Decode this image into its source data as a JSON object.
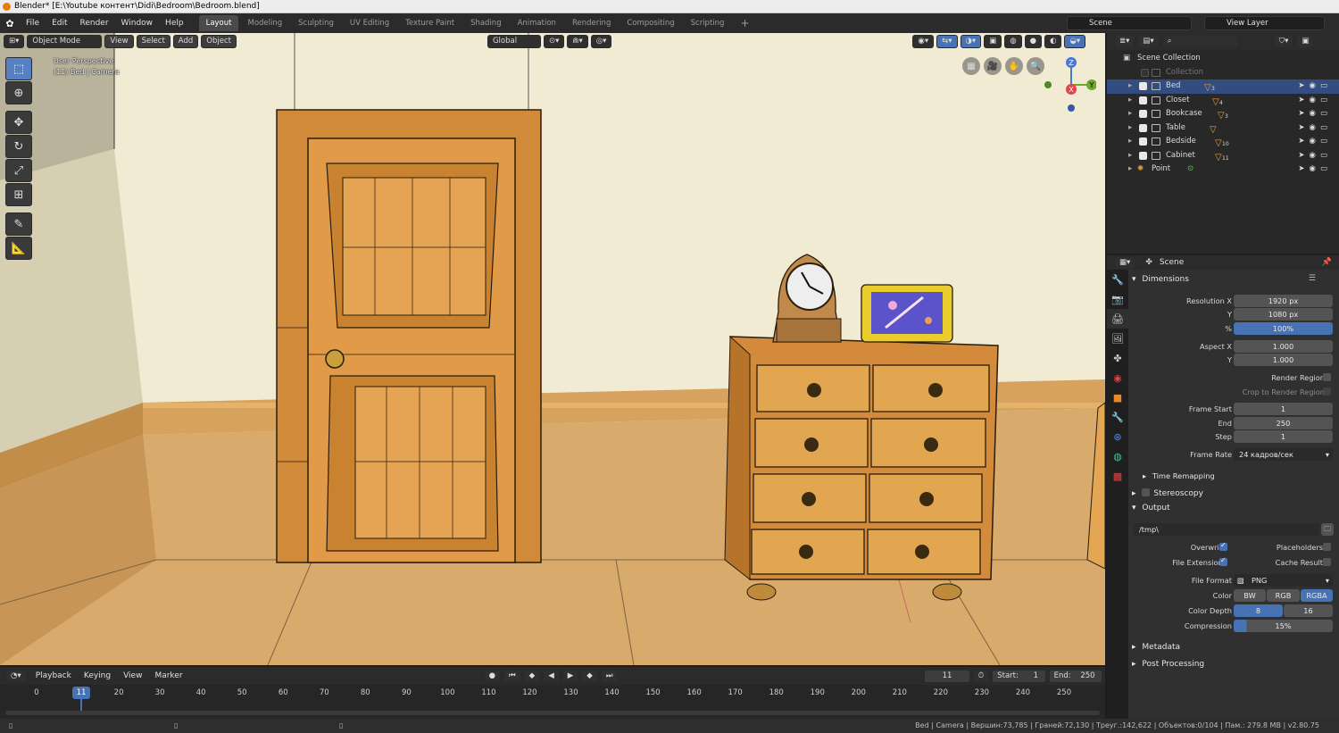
{
  "window": {
    "title": "Blender* [E:\\Youtube контент\\Didi\\Bedroom\\Bedroom.blend]"
  },
  "menu": [
    "File",
    "Edit",
    "Render",
    "Window",
    "Help"
  ],
  "workspaces": [
    "Layout",
    "Modeling",
    "Sculpting",
    "UV Editing",
    "Texture Paint",
    "Shading",
    "Animation",
    "Rendering",
    "Compositing",
    "Scripting"
  ],
  "active_workspace": "Layout",
  "scene_name": "Scene",
  "view_layer": "View Layer",
  "viewport_header": {
    "mode": "Object Mode",
    "view": "View",
    "select": "Select",
    "add": "Add",
    "object": "Object",
    "orientation": "Global"
  },
  "viewport_info": {
    "line1": "User Perspective",
    "line2": "(11) Bed | Camera"
  },
  "gizmo": {
    "z": "Z",
    "y": "Y",
    "x": "X"
  },
  "timeline": {
    "menus": [
      "Playback",
      "Keying",
      "View",
      "Marker"
    ],
    "current_frame": "11",
    "start_label": "Start:",
    "start": "1",
    "end_label": "End:",
    "end": "250",
    "ruler": [
      "0",
      "11",
      "20",
      "30",
      "40",
      "50",
      "60",
      "70",
      "80",
      "90",
      "100",
      "110",
      "120",
      "130",
      "140",
      "150",
      "160",
      "170",
      "180",
      "190",
      "200",
      "210",
      "220",
      "230",
      "240",
      "250"
    ]
  },
  "status": "Bed | Camera | Вершин:73,785 | Граней:72,130 | Треуг.:142,622 | Объектов:0/104 | Пам.: 279.8 MB | v2.80.75",
  "outliner": {
    "root": "Scene Collection",
    "collection": "Collection",
    "items": [
      {
        "name": "Bed",
        "count": "3",
        "selected": true
      },
      {
        "name": "Closet",
        "count": "4",
        "selected": false
      },
      {
        "name": "Bookcase",
        "count": "3",
        "selected": false
      },
      {
        "name": "Table",
        "count": "",
        "selected": false
      },
      {
        "name": "Bedside",
        "count": "10",
        "selected": false
      },
      {
        "name": "Cabinet",
        "count": "11",
        "selected": false
      }
    ],
    "point": "Point"
  },
  "properties": {
    "context": "Scene",
    "dimensions": "Dimensions",
    "resolution_x_label": "Resolution X",
    "resolution_x": "1920 px",
    "y_label": "Y",
    "resolution_y": "1080 px",
    "pct_label": "%",
    "resolution_pct": "100%",
    "aspect_x_label": "Aspect X",
    "aspect_x": "1.000",
    "aspect_y_label": "Y",
    "aspect_y": "1.000",
    "render_region": "Render Region",
    "crop_region": "Crop to Render Region",
    "frame_start_label": "Frame Start",
    "frame_start": "1",
    "end_label": "End",
    "frame_end": "250",
    "step_label": "Step",
    "step": "1",
    "frame_rate_label": "Frame Rate",
    "frame_rate": "24 кадров/сек",
    "time_remapping": "Time Remapping",
    "stereoscopy": "Stereoscopy",
    "output": "Output",
    "output_path": "/tmp\\",
    "overwrite": "Overwrite",
    "placeholders": "Placeholders",
    "file_extensions": "File Extensions",
    "cache_result": "Cache Result",
    "file_format_label": "File Format",
    "file_format": "PNG",
    "color_label": "Color",
    "color_bw": "BW",
    "color_rgb": "RGB",
    "color_rgba": "RGBA",
    "color_depth_label": "Color Depth",
    "depth_8": "8",
    "depth_16": "16",
    "compression_label": "Compression",
    "compression": "15%",
    "metadata": "Metadata",
    "post_processing": "Post Processing"
  },
  "colors": {
    "accent": "#4772b3",
    "selection": "#334d80",
    "wood": "#d9933f",
    "wall": "#f1ebd3"
  }
}
